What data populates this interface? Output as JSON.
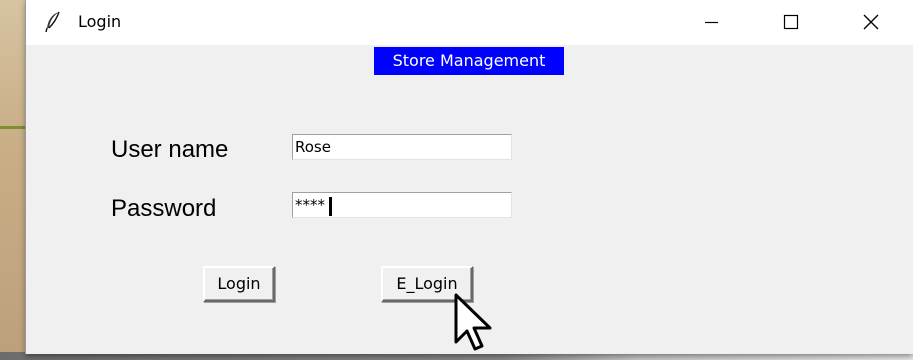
{
  "window": {
    "title": "Login",
    "icon": "feather-icon",
    "controls": [
      "minimize-icon",
      "maximize-icon",
      "close-icon"
    ]
  },
  "header": {
    "store_label": "Store Management",
    "store_label_bg": "#0000ff"
  },
  "form": {
    "username_label": "User name",
    "username_value": "Rose",
    "password_label": "Password",
    "password_value": "****"
  },
  "buttons": {
    "login": "Login",
    "e_login": "E_Login"
  }
}
